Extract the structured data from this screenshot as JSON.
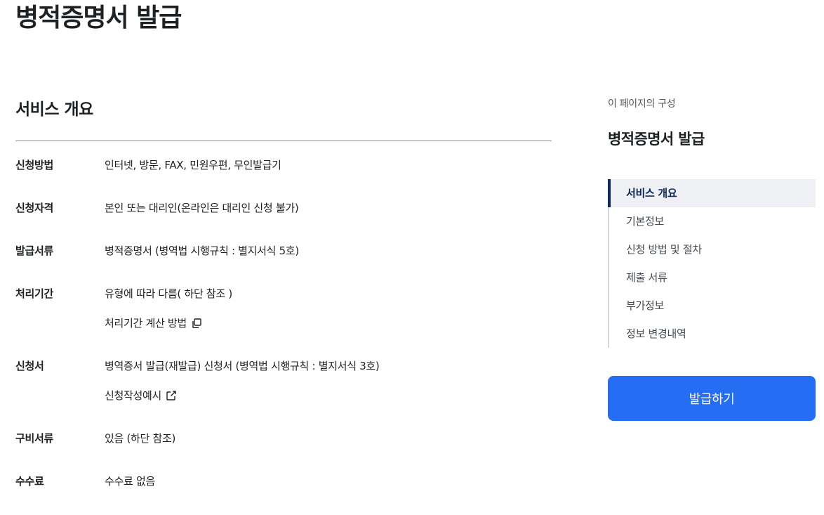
{
  "page": {
    "title": "병적증명서 발급"
  },
  "section": {
    "title": "서비스 개요"
  },
  "rows": [
    {
      "term": "신청방법",
      "lines": [
        "인터넷, 방문, FAX, 민원우편, 무인발급기"
      ]
    },
    {
      "term": "신청자격",
      "lines": [
        "본인 또는 대리인(온라인은 대리인 신청 불가)"
      ]
    },
    {
      "term": "발급서류",
      "lines": [
        "병적증명서 (병역법 시행규칙 : 별지서식 5호)"
      ]
    },
    {
      "term": "처리기간",
      "lines": [
        "유형에 따라 다름( 하단 참조 )"
      ],
      "link": {
        "label": "처리기간 계산 방법",
        "icon": "copy-icon"
      }
    },
    {
      "term": "신청서",
      "lines": [
        "병역증서 발급(재발급) 신청서 (병역법 시행규칙 : 별지서식 3호)"
      ],
      "link": {
        "label": "신청작성예시",
        "icon": "external-link-icon"
      }
    },
    {
      "term": "구비서류",
      "lines": [
        "있음 (하단 참조)"
      ]
    },
    {
      "term": "수수료",
      "lines": [
        "수수료 없음"
      ]
    }
  ],
  "aside": {
    "caption": "이 페이지의 구성",
    "title": "병적증명서 발급",
    "toc": [
      "서비스 개요",
      "기본정보",
      "신청 방법 및 절차",
      "제출 서류",
      "부가정보",
      "정보 변경내역"
    ],
    "active_index": 0,
    "button_label": "발급하기"
  },
  "colors": {
    "accent": "#256ef4",
    "active_nav": "#0b2a5b",
    "text": "#1e2124"
  }
}
